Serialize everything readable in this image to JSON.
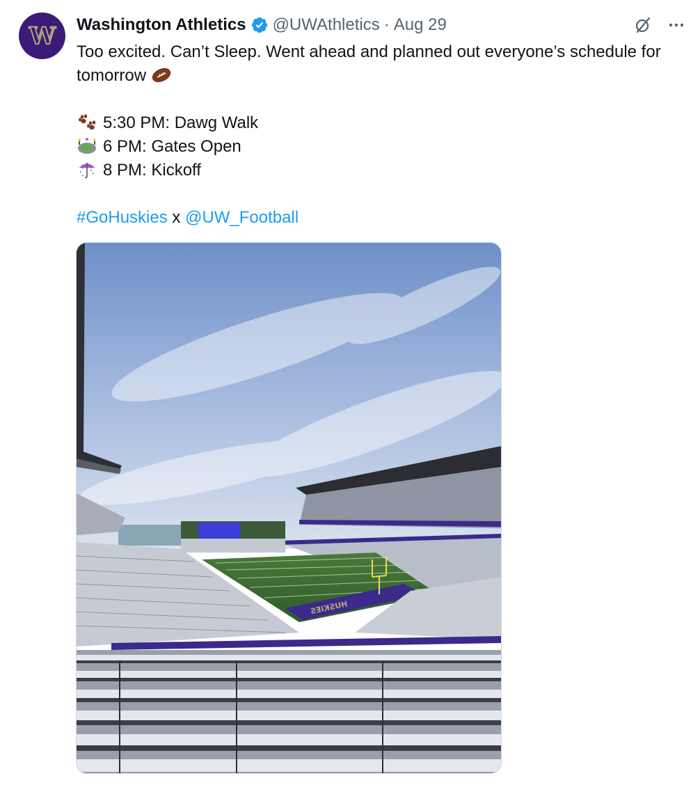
{
  "tweet": {
    "author": {
      "display_name": "Washington Athletics",
      "handle": "@UWAthletics",
      "avatar_letter": "W",
      "verified": true
    },
    "separator": "·",
    "date": "Aug 29",
    "text_line1": "Too excited. Can’t Sleep. Went ahead and planned out everyone’s schedule for tomorrow",
    "schedule": [
      {
        "icon": "paw-prints-icon",
        "text": "5:30 PM: Dawg Walk"
      },
      {
        "icon": "stadium-icon",
        "text": "6 PM: Gates Open"
      },
      {
        "icon": "umbrella-icon",
        "text": "8 PM: Kickoff"
      }
    ],
    "hashtag": "#GoHuskies",
    "connector": "x",
    "mention": "@UW_Football",
    "media": {
      "description_icon": "stadium-photo",
      "field_text": "HUSKIES"
    }
  },
  "colors": {
    "link": "#1d9bf0",
    "verified": "#1d9bf0",
    "uw_purple": "#3b1a78",
    "uw_gold": "#b7a57a",
    "muted": "#536471"
  }
}
